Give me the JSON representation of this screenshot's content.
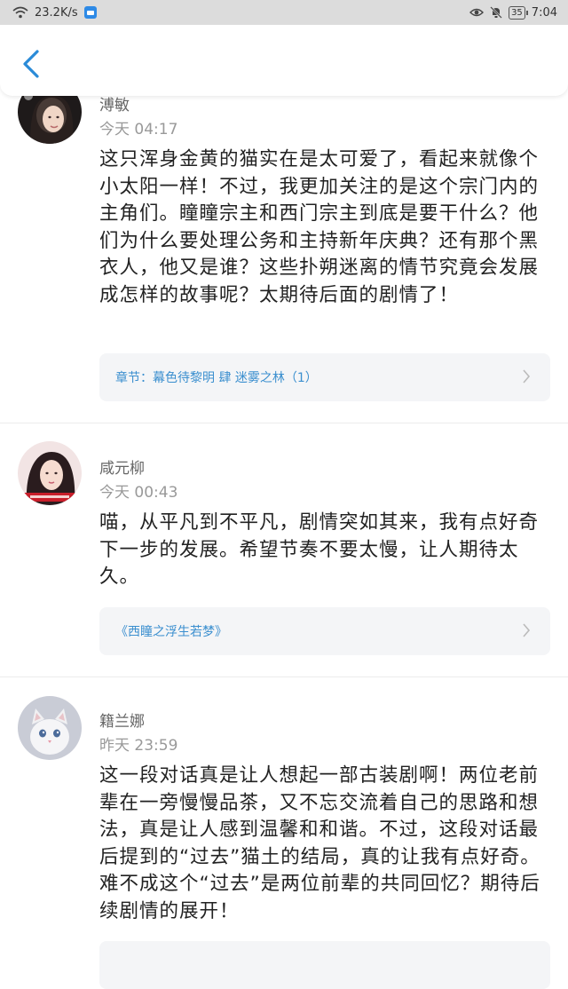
{
  "status_bar": {
    "net_speed": "23.2K/s",
    "battery": "35",
    "time": "7:04",
    "icons": [
      "wifi-icon",
      "app-notification-icon",
      "eye-icon",
      "mute-bell-icon",
      "battery-icon"
    ]
  },
  "nav": {
    "back_icon": "chevron-left-icon"
  },
  "comments": [
    {
      "name": "溥敏",
      "time": "今天 04:17",
      "text": "这只浑身金黄的猫实在是太可爱了，看起来就像个小太阳一样！不过，我更加关注的是这个宗门内的主角们。瞳瞳宗主和西门宗主到底是要干什么？他们为什么要处理公务和主持新年庆典？还有那个黑衣人，他又是谁？这些扑朔迷离的情节究竟会发展成怎样的故事呢？太期待后面的剧情了！",
      "chapter": "章节：幕色待黎明 肆 迷雾之林（1）"
    },
    {
      "name": "咸元柳",
      "time": "今天 00:43",
      "text": "喵，从平凡到不平凡，剧情突如其来，我有点好奇下一步的发展。希望节奏不要太慢，让人期待太久。",
      "chapter": "《西瞳之浮生若梦》"
    },
    {
      "name": "籍兰娜",
      "time": "昨天 23:59",
      "text": "这一段对话真是让人想起一部古装剧啊！两位老前辈在一旁慢慢品茶，又不忘交流着自己的思路和想法，真是让人感到温馨和和谐。不过，这段对话最后提到的“过去”猫土的结局，真的让我有点好奇。难不成这个“过去”是两位前辈的共同回忆？期待后续剧情的展开！"
    }
  ],
  "colors": {
    "link": "#3b8fcf",
    "card": "#f4f5f7",
    "nav_accent": "#2a8bd8"
  }
}
